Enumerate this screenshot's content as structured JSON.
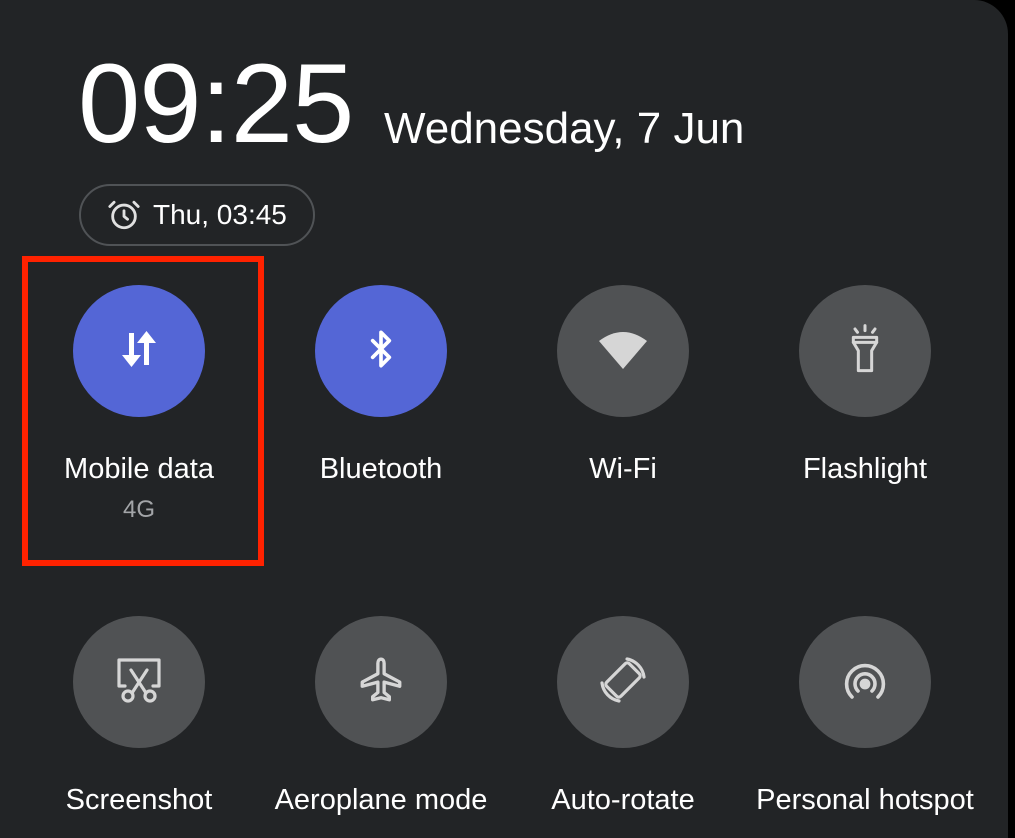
{
  "status": {
    "time": "09:25",
    "date": "Wednesday, 7 Jun",
    "alarm": {
      "icon": "alarm-clock-icon",
      "label": "Thu, 03:45"
    }
  },
  "tiles": [
    {
      "label": "Mobile data",
      "sublabel": "4G",
      "icon": "mobile-data-arrows-icon",
      "state": "on"
    },
    {
      "label": "Bluetooth",
      "icon": "bluetooth-icon",
      "state": "on"
    },
    {
      "label": "Wi-Fi",
      "icon": "wifi-icon",
      "state": "off"
    },
    {
      "label": "Flashlight",
      "icon": "flashlight-icon",
      "state": "off"
    },
    {
      "label": "Screenshot",
      "icon": "screenshot-scissors-icon",
      "state": "off"
    },
    {
      "label": "Aeroplane mode",
      "icon": "airplane-icon",
      "state": "off"
    },
    {
      "label": "Auto-rotate",
      "icon": "auto-rotate-icon",
      "state": "off"
    },
    {
      "label": "Personal hotspot",
      "icon": "hotspot-icon",
      "state": "off"
    }
  ],
  "colors": {
    "panel_background": "#222426",
    "tile_on": "#5466d6",
    "tile_off": "#505254",
    "highlight_box": "#ff2200"
  }
}
